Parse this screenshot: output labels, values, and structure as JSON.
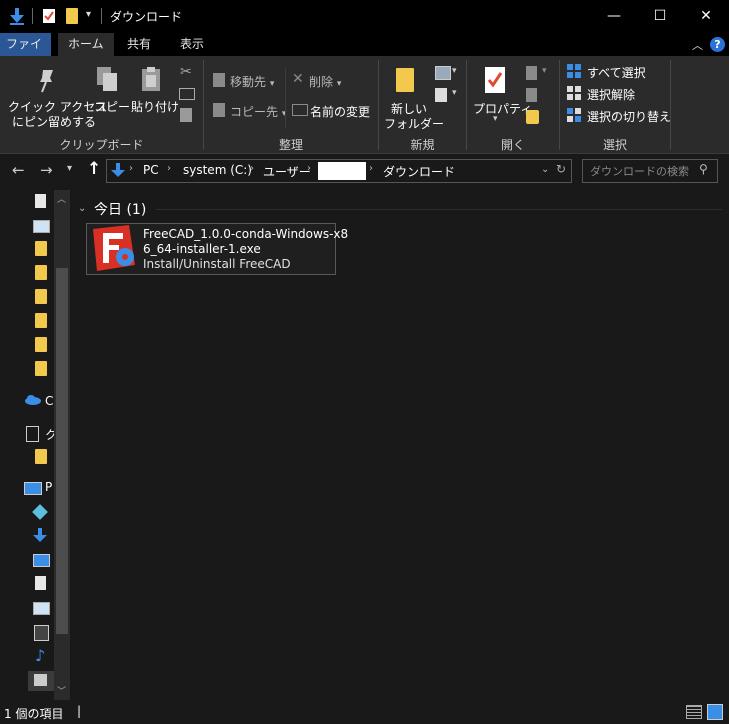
{
  "window": {
    "title": "ダウンロード",
    "minimize": "—",
    "maximize": "☐",
    "close": "✕"
  },
  "ribbon_tabs": [
    "ファイル",
    "ホーム",
    "共有",
    "表示"
  ],
  "ribbon": {
    "clipboard": {
      "label": "クリップボード",
      "pin_line1": "クイック アクセス",
      "pin_line2": "にピン留めする",
      "copy": "コピー",
      "paste": "貼り付け"
    },
    "organize": {
      "label": "整理",
      "move_to": "移動先",
      "copy_to": "コピー先",
      "delete": "削除",
      "rename": "名前の変更"
    },
    "new": {
      "label": "新規",
      "new_folder_line1": "新しい",
      "new_folder_line2": "フォルダー"
    },
    "open": {
      "label": "開く",
      "properties": "プロパティ"
    },
    "select": {
      "label": "選択",
      "select_all": "すべて選択",
      "select_none": "選択解除",
      "invert": "選択の切り替え"
    }
  },
  "address": {
    "crumbs": [
      "PC",
      "system (C:)",
      "ユーザー",
      "",
      "ダウンロード"
    ],
    "search_placeholder": "ダウンロードの検索"
  },
  "nav_pane": {
    "onedrive_label": "C",
    "network_label": "ク",
    "pc_label": "P"
  },
  "group": {
    "header": "今日 (1)"
  },
  "files": [
    {
      "name_line1": "FreeCAD_1.0.0-conda-Windows-x8",
      "name_line2": "6_64-installer-1.exe",
      "description": "Install/Uninstall FreeCAD"
    }
  ],
  "status": {
    "item_count": "1 個の項目",
    "cursor": "|"
  },
  "colors": {
    "accent": "#2b5797",
    "folder": "#f2c94c",
    "download_arrow": "#3a8ee6"
  }
}
